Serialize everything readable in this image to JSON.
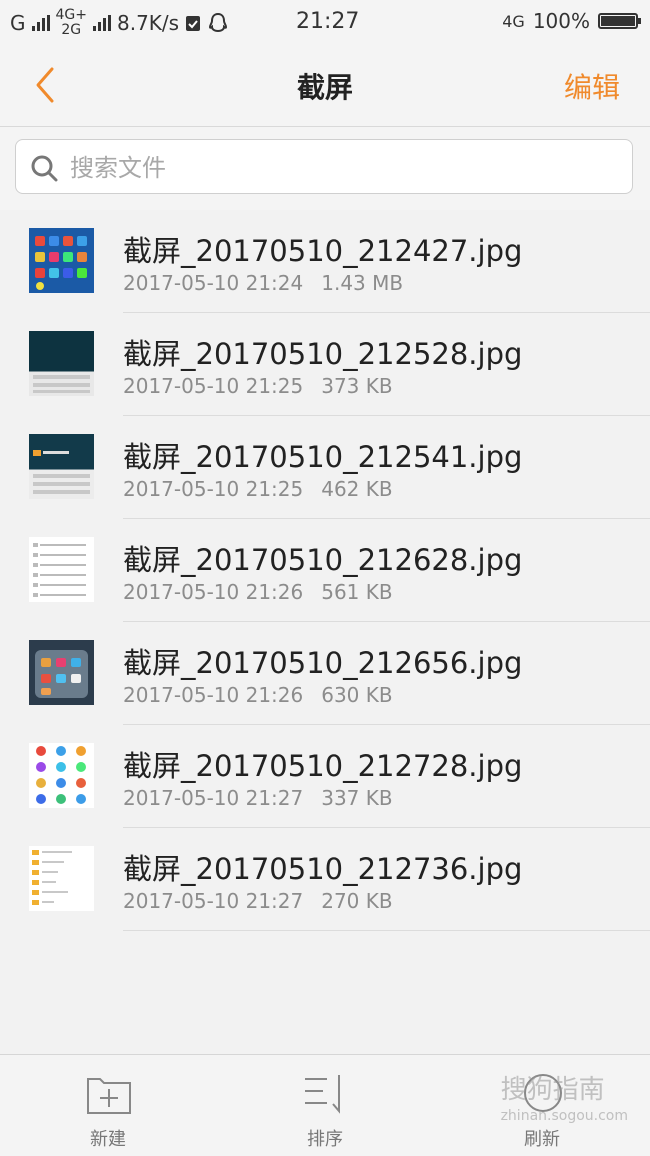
{
  "status_bar": {
    "carrier1": "G",
    "net_top": "4G+",
    "net_bottom": "2G",
    "speed": "8.7K/s",
    "time": "21:27",
    "net_right": "4G",
    "battery": "100%",
    "battery_level": 1.0
  },
  "nav": {
    "title": "截屏",
    "edit_label": "编辑"
  },
  "search": {
    "placeholder": "搜索文件"
  },
  "files": [
    {
      "name": "截屏_20170510_212427.jpg",
      "date": "2017-05-10 21:24",
      "size": "1.43 MB"
    },
    {
      "name": "截屏_20170510_212528.jpg",
      "date": "2017-05-10 21:25",
      "size": "373 KB"
    },
    {
      "name": "截屏_20170510_212541.jpg",
      "date": "2017-05-10 21:25",
      "size": "462 KB"
    },
    {
      "name": "截屏_20170510_212628.jpg",
      "date": "2017-05-10 21:26",
      "size": "561 KB"
    },
    {
      "name": "截屏_20170510_212656.jpg",
      "date": "2017-05-10 21:26",
      "size": "630 KB"
    },
    {
      "name": "截屏_20170510_212728.jpg",
      "date": "2017-05-10 21:27",
      "size": "337 KB"
    },
    {
      "name": "截屏_20170510_212736.jpg",
      "date": "2017-05-10 21:27",
      "size": "270 KB"
    }
  ],
  "toolbar": {
    "new_label": "新建",
    "sort_label": "排序",
    "refresh_label": "刷新"
  },
  "watermark": {
    "text": "搜狗指南",
    "url": "zhinan.sogou.com"
  },
  "colors": {
    "accent": "#f08a2c",
    "background": "#f2f2f2"
  }
}
